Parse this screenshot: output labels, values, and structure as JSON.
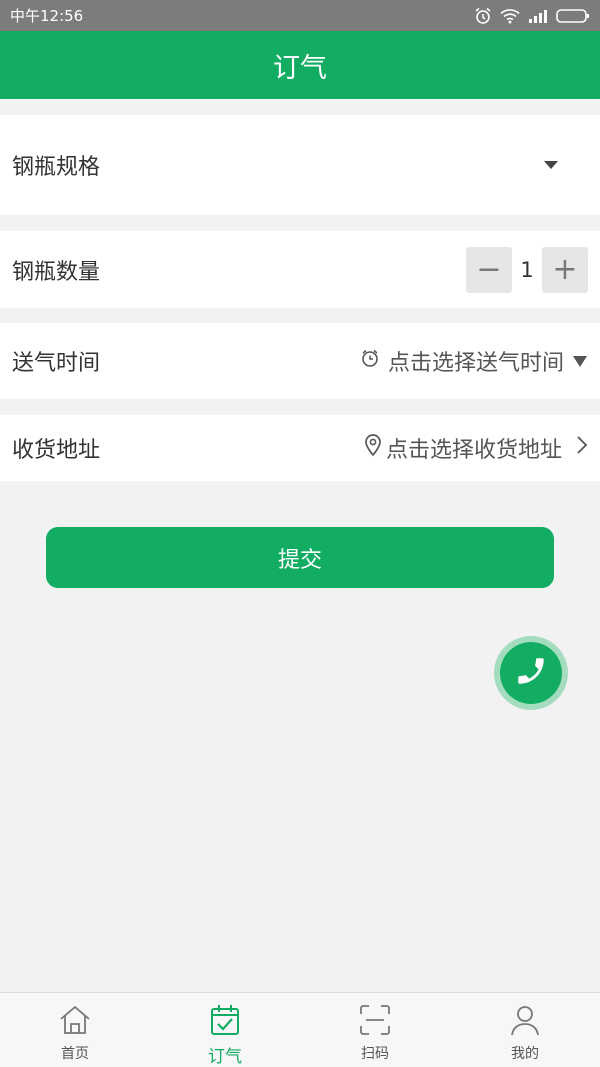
{
  "status_bar": {
    "time": "中午12:56"
  },
  "header": {
    "title": "订气"
  },
  "form": {
    "cylinder_spec_label": "钢瓶规格",
    "cylinder_qty_label": "钢瓶数量",
    "qty_minus": "−",
    "qty_value": "1",
    "qty_plus": "+",
    "delivery_time_label": "送气时间",
    "delivery_time_placeholder": "点击选择送气时间",
    "address_label": "收货地址",
    "address_placeholder": "点击选择收货地址"
  },
  "submit_label": "提交",
  "colors": {
    "primary": "#12ad63",
    "status_bar": "#7c7c7c",
    "background": "#f2f2f2"
  },
  "tabs": [
    {
      "label": "首页",
      "icon": "home-icon",
      "active": false
    },
    {
      "label": "订气",
      "icon": "calendar-check-icon",
      "active": true
    },
    {
      "label": "扫码",
      "icon": "scan-icon",
      "active": false
    },
    {
      "label": "我的",
      "icon": "user-icon",
      "active": false
    }
  ]
}
